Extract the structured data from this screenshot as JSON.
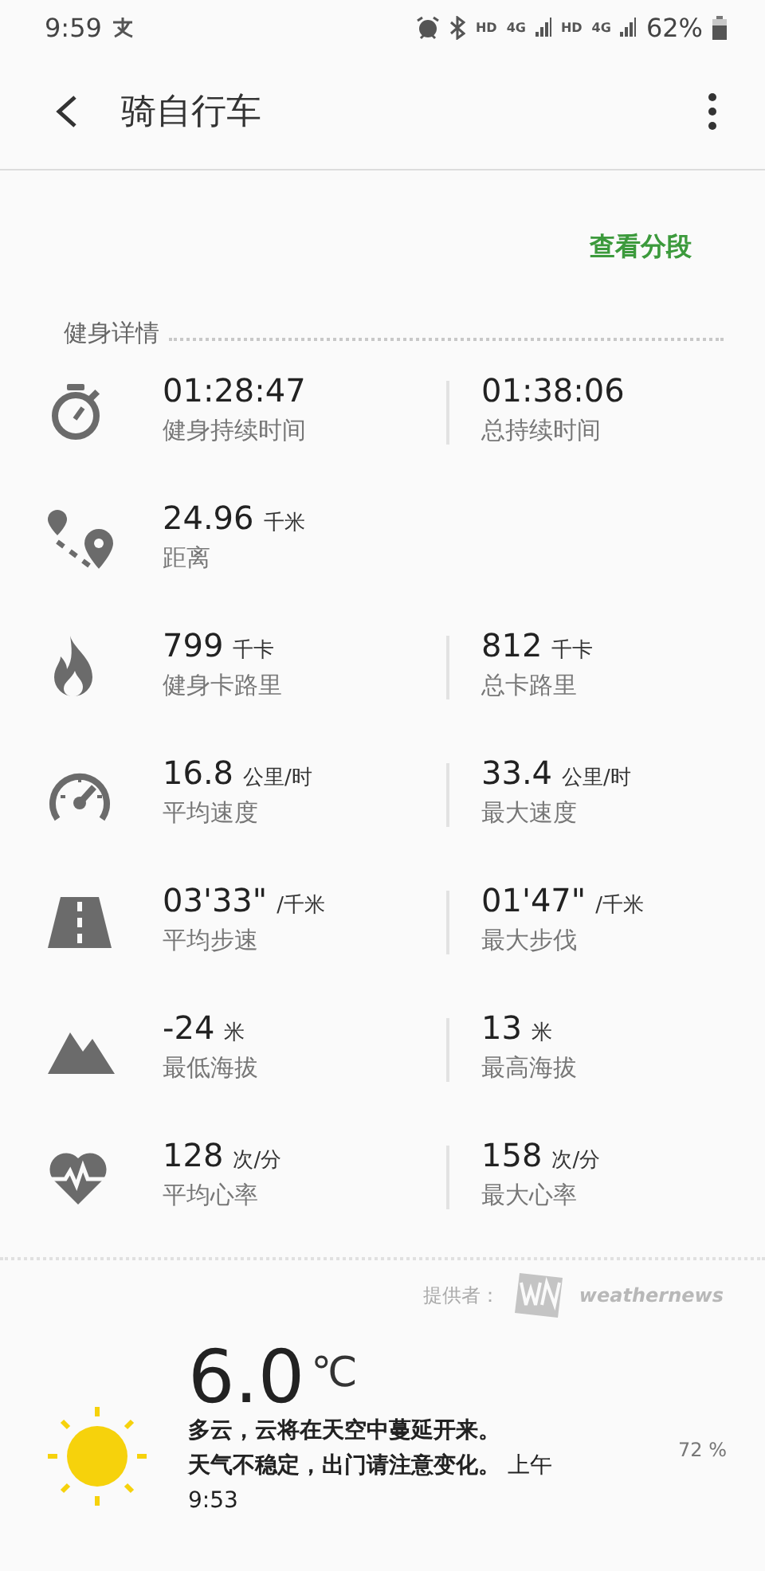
{
  "status_bar": {
    "time": "9:59",
    "networks": [
      {
        "hd": "HD",
        "type": "4G"
      },
      {
        "hd": "HD",
        "type": "4G"
      }
    ],
    "battery": "62%"
  },
  "header": {
    "title": "骑自行车"
  },
  "segments_link": "查看分段",
  "section_title": "健身详情",
  "stats": [
    {
      "kind": "stopwatch",
      "items": [
        {
          "value": "01:28:47",
          "label": "健身持续时间"
        },
        {
          "value": "01:38:06",
          "label": "总持续时间"
        }
      ]
    },
    {
      "kind": "route",
      "items": [
        {
          "value": "24.96",
          "unit": "千米",
          "label": "距离"
        }
      ]
    },
    {
      "kind": "flame",
      "items": [
        {
          "value": "799",
          "unit": "千卡",
          "label": "健身卡路里"
        },
        {
          "value": "812",
          "unit": "千卡",
          "label": "总卡路里"
        }
      ]
    },
    {
      "kind": "speedometer",
      "items": [
        {
          "value": "16.8",
          "unit": "公里/时",
          "label": "平均速度"
        },
        {
          "value": "33.4",
          "unit": "公里/时",
          "label": "最大速度"
        }
      ]
    },
    {
      "kind": "road",
      "items": [
        {
          "value": "03'33\"",
          "unit": "/千米",
          "label": "平均步速"
        },
        {
          "value": "01'47\"",
          "unit": "/千米",
          "label": "最大步伐"
        }
      ]
    },
    {
      "kind": "mountain",
      "items": [
        {
          "value": "-24",
          "unit": "米",
          "label": "最低海拔"
        },
        {
          "value": "13",
          "unit": "米",
          "label": "最高海拔"
        }
      ]
    },
    {
      "kind": "heart",
      "items": [
        {
          "value": "128",
          "unit": "次/分",
          "label": "平均心率"
        },
        {
          "value": "158",
          "unit": "次/分",
          "label": "最大心率"
        }
      ]
    }
  ],
  "weather": {
    "provider_label": "提供者：",
    "provider_name": "weathernews",
    "temperature": "6.0",
    "temp_unit": "℃",
    "humidity": "72 %",
    "lines": [
      "**多云，云将在天空中蔓延开来。**",
      "**天气不稳定，出门请注意变化。** 上午 9:53"
    ]
  }
}
